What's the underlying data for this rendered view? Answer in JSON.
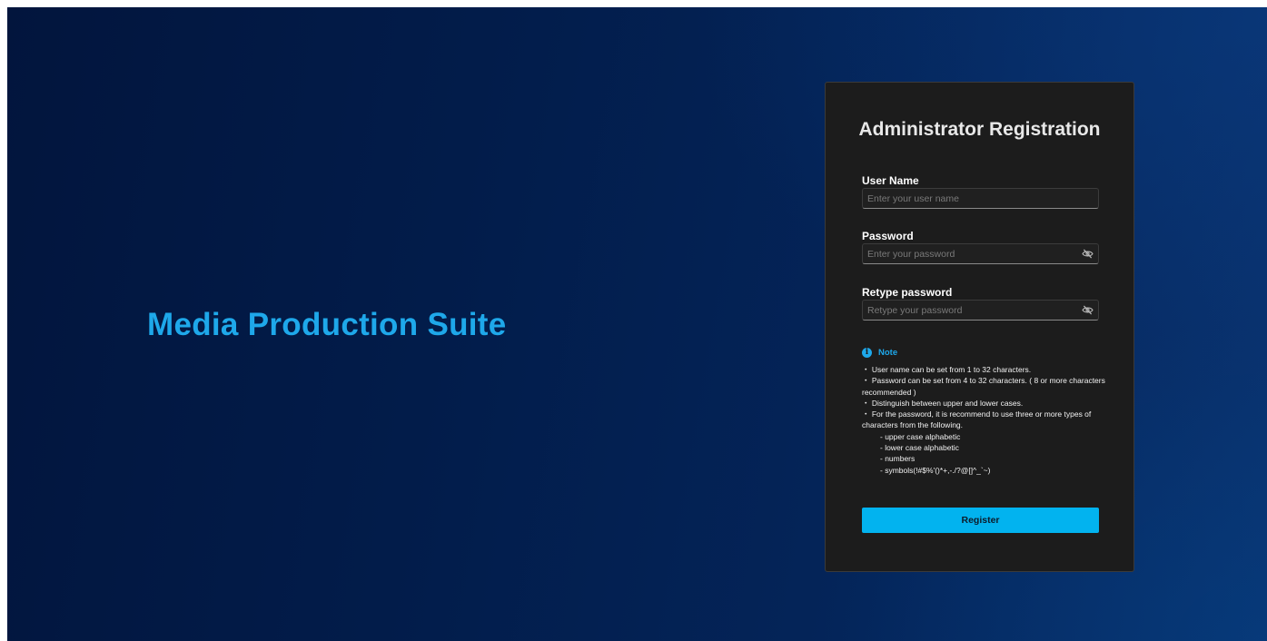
{
  "brand": {
    "title": "Media Production Suite",
    "color": "#1ea8ea"
  },
  "form": {
    "title": "Administrator Registration",
    "username": {
      "label": "User Name",
      "placeholder": "Enter your user name",
      "value": ""
    },
    "password": {
      "label": "Password",
      "placeholder": "Enter your password",
      "value": "",
      "toggle_icon": "eye-off-icon"
    },
    "retype_password": {
      "label": "Retype password",
      "placeholder": "Retype your password",
      "value": "",
      "toggle_icon": "eye-off-icon"
    },
    "note": {
      "icon": "info-icon",
      "title": "Note",
      "lines": [
        "・ User name can be set from 1 to 32 characters.",
        "・ Password can be set from 4 to 32 characters. ( 8 or more characters recommended )",
        "・ Distinguish between upper and lower cases.",
        "・ For the password, it is recommend to use three or more types of characters from the following."
      ],
      "sub_items": [
        "- upper case alphabetic",
        "- lower case alphabetic",
        "- numbers",
        "- symbols(!#$%'()*+,-./?@[]^_`~)"
      ]
    },
    "register_label": "Register",
    "accent_color": "#02b3ef"
  }
}
